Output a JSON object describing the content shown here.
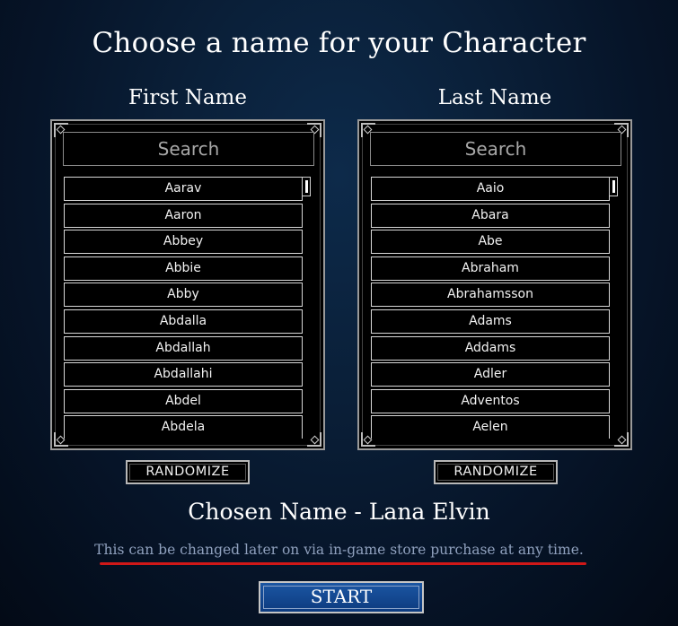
{
  "title": "Choose a name for your Character",
  "first": {
    "heading": "First Name",
    "search_placeholder": "Search",
    "items": [
      "Aarav",
      "Aaron",
      "Abbey",
      "Abbie",
      "Abby",
      "Abdalla",
      "Abdallah",
      "Abdallahi",
      "Abdel",
      "Abdela"
    ],
    "randomize_label": "RANDOMIZE"
  },
  "last": {
    "heading": "Last Name",
    "search_placeholder": "Search",
    "items": [
      "Aaio",
      "Abara",
      "Abe",
      "Abraham",
      "Abrahamsson",
      "Adams",
      "Addams",
      "Adler",
      "Adventos",
      "Aelen"
    ],
    "randomize_label": "RANDOMIZE"
  },
  "chosen_name": "Chosen Name - Lana Elvin",
  "note": "This can be changed later on via in-game store purchase at any time.",
  "start_label": "START",
  "colors": {
    "accent_blue": "#0d3b7f",
    "underline_red": "#d01818"
  }
}
